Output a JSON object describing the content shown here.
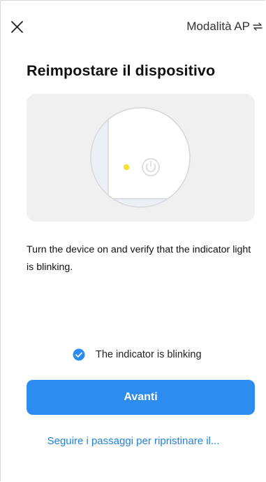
{
  "header": {
    "close_icon": "close-icon",
    "mode_label": "Modalità AP",
    "mode_icon": "swap-arrows-icon"
  },
  "title": "Reimpostare il dispositivo",
  "illustration": {
    "indicator_color": "#f5e03a",
    "power_icon": "power-icon"
  },
  "instruction": "Turn the device on and verify that the indicator light is blinking.",
  "confirm": {
    "checked": true,
    "label": "The indicator is blinking",
    "color": "#2d8cf0"
  },
  "primary_button": {
    "label": "Avanti",
    "color": "#2d8cf0"
  },
  "secondary_link": {
    "label": "Seguire i passaggi per ripristinare il...",
    "color": "#1e82e6"
  }
}
